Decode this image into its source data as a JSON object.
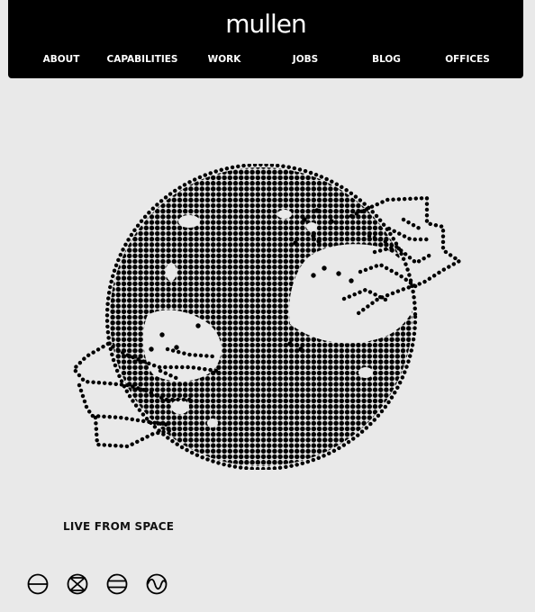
{
  "header": {
    "logo": "mullen",
    "nav": [
      {
        "label": "ABOUT"
      },
      {
        "label": "CAPABILITIES"
      },
      {
        "label": "WORK"
      },
      {
        "label": "JOBS"
      },
      {
        "label": "BLOG"
      },
      {
        "label": "OFFICES"
      }
    ]
  },
  "main": {
    "caption": "LIVE FROM SPACE",
    "graphic": "dot-matrix-globe"
  },
  "controls": [
    {
      "icon": "circle-horizontal-line-icon"
    },
    {
      "icon": "circle-hourglass-icon"
    },
    {
      "icon": "circle-double-line-icon"
    },
    {
      "icon": "circle-wave-icon"
    }
  ],
  "colors": {
    "background": "#e9e9e9",
    "header": "#000000",
    "ink": "#000000"
  }
}
